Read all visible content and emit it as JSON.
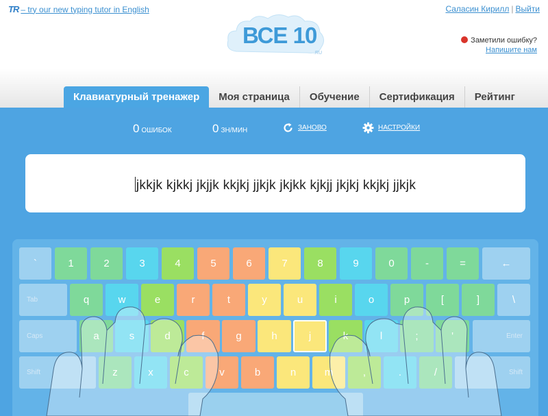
{
  "topbar": {
    "promo_logo": "TR",
    "promo_text": "– try our new typing tutor in English",
    "user_name": "Саласин Кирилл",
    "separator": "|",
    "logout": "Выйти"
  },
  "logo": {
    "text": "ВСЕ 10",
    "domain": ".RU"
  },
  "report": {
    "question": "Заметили ошибку?",
    "link": "Напишите нам"
  },
  "nav": {
    "tabs": [
      {
        "label": "Клавиатурный тренажер",
        "active": true
      },
      {
        "label": "Моя страница"
      },
      {
        "label": "Обучение"
      },
      {
        "label": "Сертификация"
      },
      {
        "label": "Рейтинг"
      }
    ]
  },
  "stats": {
    "errors_value": "0",
    "errors_label": "ошибок",
    "speed_value": "0",
    "speed_label": "зн/мин",
    "restart_label": "заново",
    "settings_label": "настройки"
  },
  "exercise_text": "jkkjk kjkkj jkjjk kkjkj jjkjk jkjkk kjkjj jkjkj kkjkj jjkjk",
  "colors": {
    "main_bg": "#4ea4e2",
    "keyboard_bg": "#63b3e8",
    "pinky": "#7fd99a",
    "ring": "#58d6ee",
    "middle": "#9adf62",
    "index_left": "#f9a877",
    "index_right": "#fbe77b",
    "thumb": "#9ad0ee",
    "mod": "#9ed1f0"
  },
  "keyboard": {
    "row1": [
      "`",
      "1",
      "2",
      "3",
      "4",
      "5",
      "6",
      "7",
      "8",
      "9",
      "0",
      "-",
      "=",
      "←"
    ],
    "row2_mod": "Tab",
    "row2": [
      "q",
      "w",
      "e",
      "r",
      "t",
      "y",
      "u",
      "i",
      "o",
      "p",
      "[",
      "]",
      "\\"
    ],
    "row3_mod": "Caps",
    "row3": [
      "a",
      "s",
      "d",
      "f",
      "g",
      "h",
      "j",
      "k",
      "l",
      ";",
      "'"
    ],
    "row3_enter": "Enter",
    "row4_mod": "Shift",
    "row4": [
      "z",
      "x",
      "c",
      "v",
      "b",
      "n",
      "m",
      ",",
      ".",
      "/"
    ],
    "row4_shift_right": "Shift",
    "active_key": "j"
  }
}
